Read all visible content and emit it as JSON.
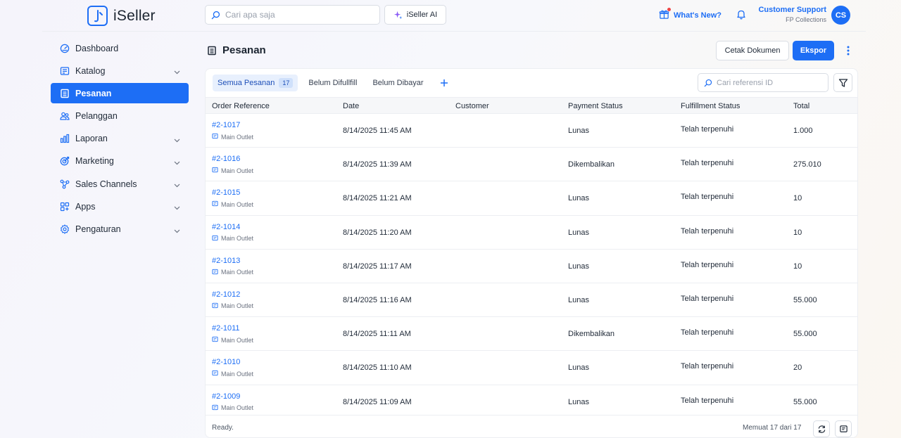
{
  "app": {
    "name": "iSeller"
  },
  "header": {
    "search_placeholder": "Cari apa saja",
    "ai_label": "iSeller AI",
    "whats_new": "What's New?",
    "user_name": "Customer Support",
    "user_company": "FP Collections",
    "avatar_initials": "CS"
  },
  "sidebar": {
    "items": [
      {
        "label": "Dashboard",
        "icon": "dashboard-icon",
        "expandable": false,
        "active": false
      },
      {
        "label": "Katalog",
        "icon": "catalog-icon",
        "expandable": true,
        "active": false
      },
      {
        "label": "Pesanan",
        "icon": "orders-icon",
        "expandable": false,
        "active": true
      },
      {
        "label": "Pelanggan",
        "icon": "customers-icon",
        "expandable": false,
        "active": false
      },
      {
        "label": "Laporan",
        "icon": "reports-icon",
        "expandable": true,
        "active": false
      },
      {
        "label": "Marketing",
        "icon": "marketing-icon",
        "expandable": true,
        "active": false
      },
      {
        "label": "Sales Channels",
        "icon": "sales-channels-icon",
        "expandable": true,
        "active": false
      },
      {
        "label": "Apps",
        "icon": "apps-icon",
        "expandable": true,
        "active": false
      },
      {
        "label": "Pengaturan",
        "icon": "settings-icon",
        "expandable": true,
        "active": false
      }
    ]
  },
  "page": {
    "title": "Pesanan",
    "cetak_label": "Cetak Dokumen",
    "ekspor_label": "Ekspor"
  },
  "tabs": {
    "all_label": "Semua Pesanan",
    "all_count": "17",
    "unfulfilled_label": "Belum Difullfill",
    "unpaid_label": "Belum Dibayar"
  },
  "ref_search_placeholder": "Cari referensi ID",
  "table": {
    "headers": {
      "ref": "Order Reference",
      "date": "Date",
      "customer": "Customer",
      "payment": "Payment Status",
      "fulfillment": "Fulfillment Status",
      "total": "Total"
    },
    "rows": [
      {
        "ref": "#2-1017",
        "outlet": "Main Outlet",
        "date": "8/14/2025 11:45 AM",
        "customer": "",
        "payment": "Lunas",
        "fulfillment": "Telah terpenuhi",
        "total": "1.000"
      },
      {
        "ref": "#2-1016",
        "outlet": "Main Outlet",
        "date": "8/14/2025 11:39 AM",
        "customer": "",
        "payment": "Dikembalikan",
        "fulfillment": "Telah terpenuhi",
        "total": "275.010"
      },
      {
        "ref": "#2-1015",
        "outlet": "Main Outlet",
        "date": "8/14/2025 11:21 AM",
        "customer": "",
        "payment": "Lunas",
        "fulfillment": "Telah terpenuhi",
        "total": "10"
      },
      {
        "ref": "#2-1014",
        "outlet": "Main Outlet",
        "date": "8/14/2025 11:20 AM",
        "customer": "",
        "payment": "Lunas",
        "fulfillment": "Telah terpenuhi",
        "total": "10"
      },
      {
        "ref": "#2-1013",
        "outlet": "Main Outlet",
        "date": "8/14/2025 11:17 AM",
        "customer": "",
        "payment": "Lunas",
        "fulfillment": "Telah terpenuhi",
        "total": "10"
      },
      {
        "ref": "#2-1012",
        "outlet": "Main Outlet",
        "date": "8/14/2025 11:16 AM",
        "customer": "",
        "payment": "Lunas",
        "fulfillment": "Telah terpenuhi",
        "total": "55.000"
      },
      {
        "ref": "#2-1011",
        "outlet": "Main Outlet",
        "date": "8/14/2025 11:11 AM",
        "customer": "",
        "payment": "Dikembalikan",
        "fulfillment": "Telah terpenuhi",
        "total": "55.000"
      },
      {
        "ref": "#2-1010",
        "outlet": "Main Outlet",
        "date": "8/14/2025 11:10 AM",
        "customer": "",
        "payment": "Lunas",
        "fulfillment": "Telah terpenuhi",
        "total": "20"
      },
      {
        "ref": "#2-1009",
        "outlet": "Main Outlet",
        "date": "8/14/2025 11:09 AM",
        "customer": "",
        "payment": "Lunas",
        "fulfillment": "Telah terpenuhi",
        "total": "55.000"
      }
    ]
  },
  "footer": {
    "status": "Ready.",
    "loaded": "Memuat 17 dari 17"
  },
  "colors": {
    "accent": "#1d6ef5"
  }
}
